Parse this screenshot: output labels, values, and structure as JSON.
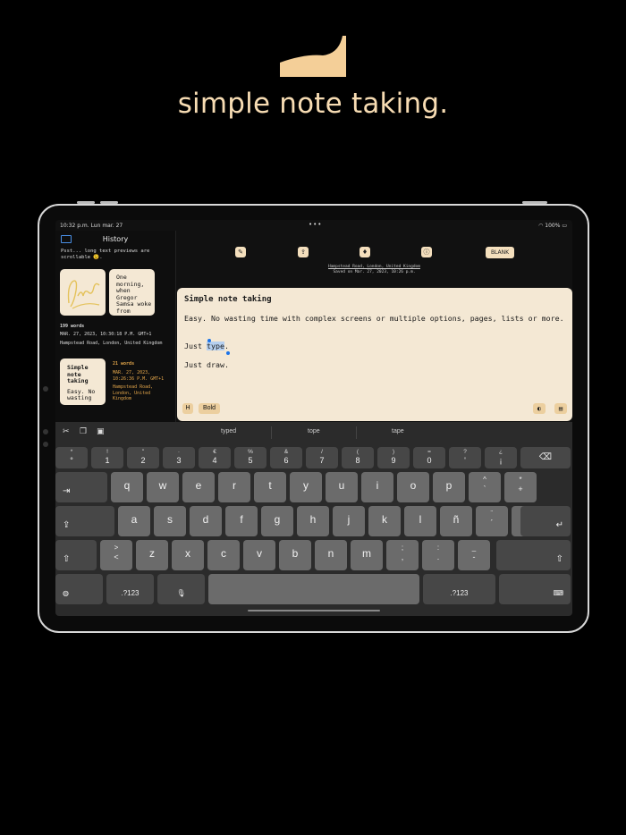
{
  "tagline": "simple note taking.",
  "status": {
    "time": "10:32 p.m.  Lun mar. 27",
    "dots": "•••",
    "battery": "100%"
  },
  "sidebar": {
    "title": "History",
    "info": "Psst... long text previews are scrollable 😉.",
    "card1": {
      "drawing_text": "Draw!",
      "words": "199 words",
      "date": "MAR. 27, 2023, 10:30:18 P.M. GMT+1",
      "location": "Hampstead Road, London, United Kingdom"
    },
    "card2": {
      "text": "One morning, when Gregor Samsa woke from"
    },
    "card3": {
      "title": "Simple note taking",
      "text": "Easy. No wasting",
      "words": "21 words",
      "date": "MAR. 27, 2023, 10:26:36 P.M. GMT+1",
      "location": "Hampstead Road, London, United Kingdom"
    }
  },
  "toolbar": {
    "blank_label": "BLANK",
    "location_line": "Hampstead Road, London, United Kingdom",
    "saved_line": "Saved on Mar. 27, 2023, 10:26 p.m."
  },
  "note": {
    "title": "Simple note taking",
    "para1": "Easy. No wasting time with complex screens or multiple options, pages, lists or more.",
    "para2_pre": "Just ",
    "para2_sel": "type",
    "para2_post": ".",
    "para3": "Just draw.",
    "chip_h": "H",
    "chip_bold": "Bold"
  },
  "keyboard": {
    "suggestions": [
      "typed",
      "tope",
      "tape"
    ],
    "row1": [
      [
        "*",
        "°"
      ],
      [
        "!",
        "1"
      ],
      [
        "\"",
        "2"
      ],
      [
        "·",
        "3"
      ],
      [
        "€",
        "4"
      ],
      [
        "%",
        "5"
      ],
      [
        "&",
        "6"
      ],
      [
        "/",
        "7"
      ],
      [
        "(",
        "8"
      ],
      [
        ")",
        "9"
      ],
      [
        "=",
        "0"
      ],
      [
        "?",
        "'"
      ],
      [
        "¿",
        "¡"
      ]
    ],
    "row2": [
      "q",
      "w",
      "e",
      "r",
      "t",
      "y",
      "u",
      "i",
      "o",
      "p"
    ],
    "row2_extra": [
      [
        "^",
        "`"
      ],
      [
        "*",
        "+"
      ]
    ],
    "row3": [
      "a",
      "s",
      "d",
      "f",
      "g",
      "h",
      "j",
      "k",
      "l",
      "ñ"
    ],
    "row3_extra": [
      [
        "¨",
        "´"
      ],
      [
        "ç",
        ""
      ]
    ],
    "row4_first": [
      ">",
      "<"
    ],
    "row4": [
      "z",
      "x",
      "c",
      "v",
      "b",
      "n",
      "m"
    ],
    "row4_extra": [
      [
        ";",
        ","
      ],
      [
        ":",
        "."
      ],
      [
        "_",
        "-"
      ]
    ],
    "numkey": ".?123"
  }
}
